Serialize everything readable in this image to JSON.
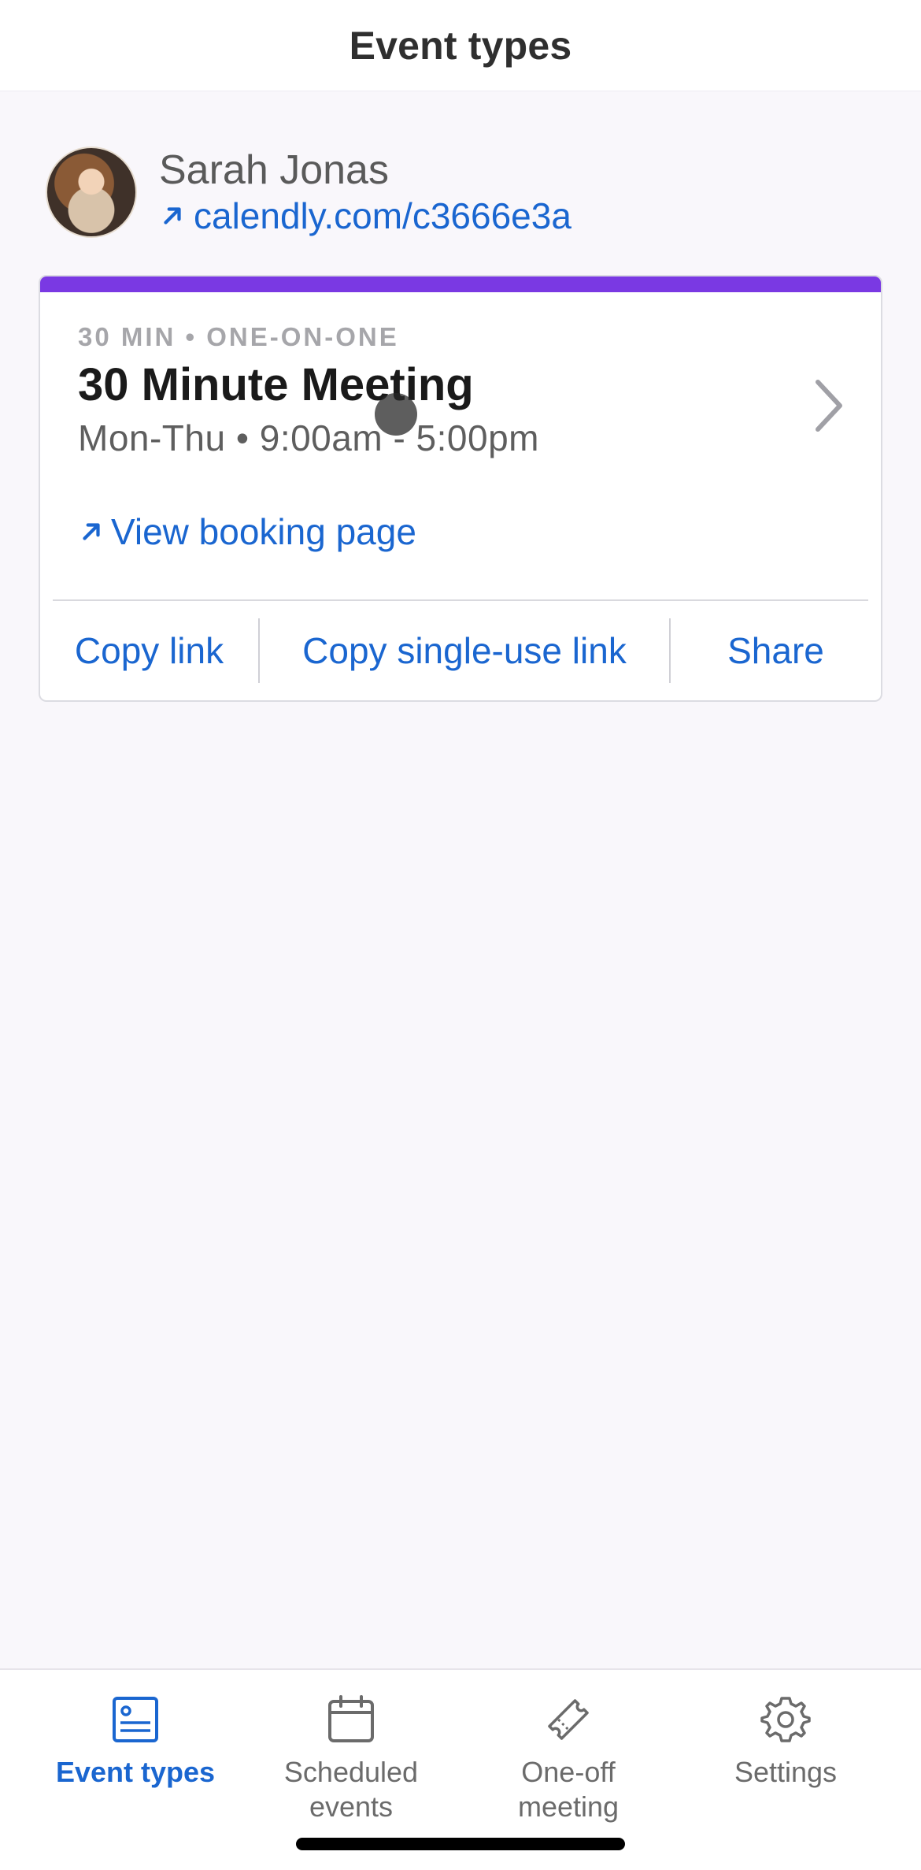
{
  "header": {
    "title": "Event types"
  },
  "profile": {
    "name": "Sarah Jonas",
    "link": "calendly.com/c3666e3a"
  },
  "event_card": {
    "accent_color": "#7a39e3",
    "meta": "30 MIN • ONE-ON-ONE",
    "title": "30 Minute Meeting",
    "hours": "Mon-Thu • 9:00am - 5:00pm",
    "view_booking": "View booking page",
    "actions": {
      "copy_link": "Copy link",
      "copy_single_use": "Copy single-use link",
      "share": "Share"
    }
  },
  "tabbar": {
    "tabs": [
      {
        "label": "Event types",
        "icon": "event-types-icon",
        "active": true
      },
      {
        "label": "Scheduled\nevents",
        "icon": "calendar-icon",
        "active": false
      },
      {
        "label": "One-off\nmeeting",
        "icon": "ticket-icon",
        "active": false
      },
      {
        "label": "Settings",
        "icon": "gear-icon",
        "active": false
      }
    ]
  },
  "colors": {
    "link": "#1a66d0",
    "active_tab": "#1a66d0",
    "inactive_tab": "#6b6b6b"
  }
}
